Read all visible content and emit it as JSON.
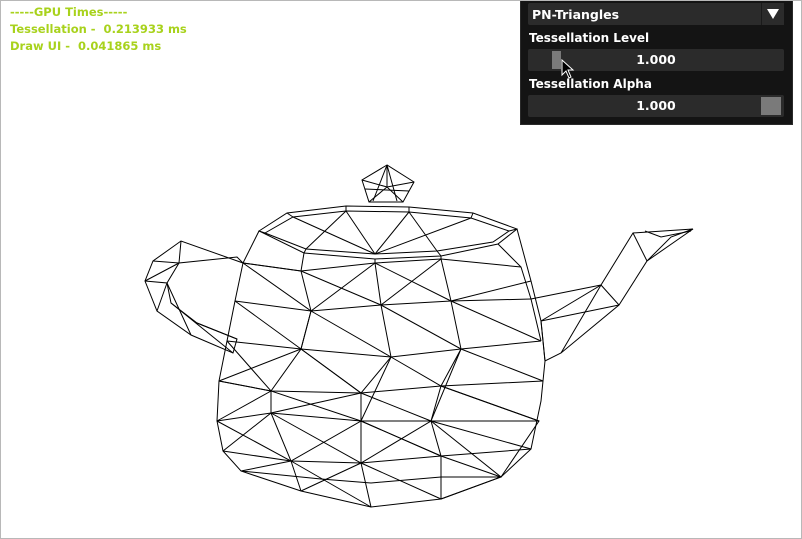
{
  "stats": {
    "header": "-----GPU Times-----",
    "tessellation": "Tessellation -  0.213933 ms",
    "draw_ui": "Draw UI -  0.041865 ms"
  },
  "panel": {
    "mode_dropdown": {
      "selected": "PN-Triangles"
    },
    "tess_level": {
      "label": "Tessellation Level",
      "value": "1.000",
      "fraction": 0.0
    },
    "tess_alpha": {
      "label": "Tessellation Alpha",
      "value": "1.000",
      "fraction": 1.0
    }
  },
  "colors": {
    "stats_text": "#a8d21c",
    "panel_bg": "#141414",
    "widget_bg": "#2b2b2b",
    "grab": "#7a7a7a"
  },
  "icons": {
    "dropdown_arrow": "triangle-down-icon",
    "cursor": "mouse-cursor-icon"
  }
}
